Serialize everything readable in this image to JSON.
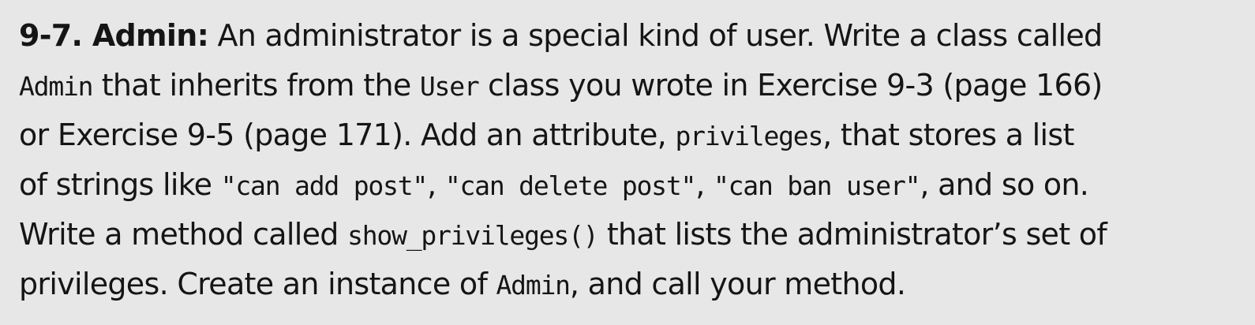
{
  "exercise": {
    "heading": "9-7. Admin:",
    "line1": " An administrator is a special kind of user. Write a class called",
    "code_admin": "Admin",
    "line2_a": " that inherits from the ",
    "code_user": "User",
    "line2_b": " class you wrote in Exercise 9-3 (page 166)",
    "line3_a": "or Exercise 9-5 (page 171). Add an attribute, ",
    "code_privileges": "privileges",
    "line3_b": ", that stores a list",
    "line4_a": "of strings like ",
    "code_add_post": "\"can add post\"",
    "sep1": ", ",
    "code_delete_post": "\"can delete post\"",
    "sep2": ", ",
    "code_ban_user": "\"can ban user\"",
    "line4_b": ", and so on.",
    "line5_a": "Write a method called ",
    "code_show_privileges": "show_privileges()",
    "line5_b": " that lists the administrator’s set of",
    "line6_a": "privileges. Create an instance of ",
    "code_admin_2": "Admin",
    "line6_b": ", and call your method."
  }
}
